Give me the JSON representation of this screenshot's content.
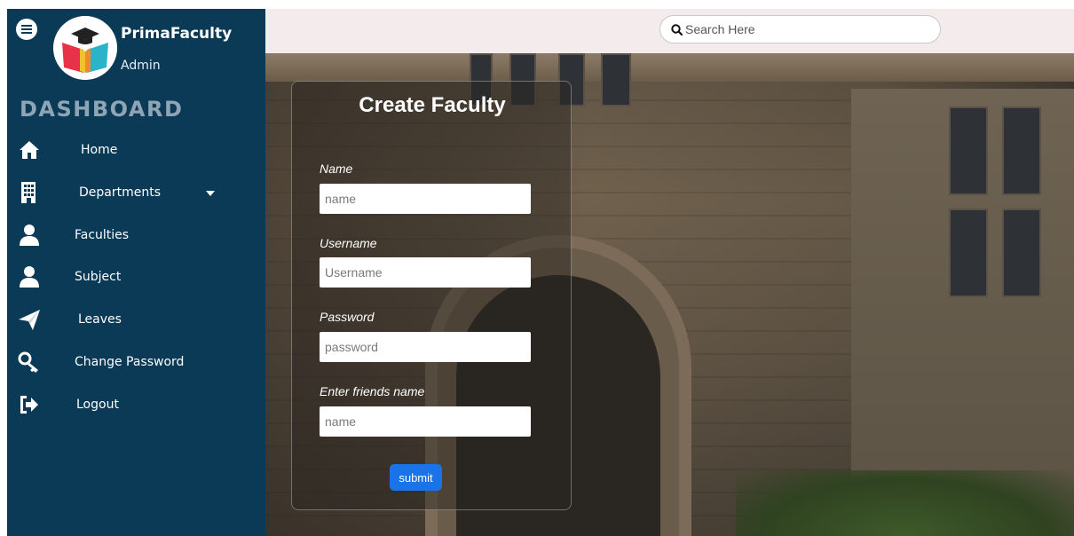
{
  "brand": {
    "name": "PrimaFaculty",
    "role": "Admin",
    "logo_icon": "graduation-cap-book-logo"
  },
  "sidebar": {
    "title": "DASHBOARD",
    "items": [
      {
        "label": "Home",
        "icon": "home-icon"
      },
      {
        "label": "Departments",
        "icon": "building-icon",
        "has_dropdown": true
      },
      {
        "label": "Faculties",
        "icon": "user-icon"
      },
      {
        "label": "Subject",
        "icon": "user-icon"
      },
      {
        "label": "Leaves",
        "icon": "paper-plane-icon"
      },
      {
        "label": "Change Password",
        "icon": "key-icon"
      },
      {
        "label": "Logout",
        "icon": "sign-out-icon"
      }
    ]
  },
  "search": {
    "placeholder": "Search Here",
    "icon": "search-icon"
  },
  "form": {
    "title": "Create Faculty",
    "fields": [
      {
        "label": "Name",
        "placeholder": "name"
      },
      {
        "label": "Username",
        "placeholder": "Username"
      },
      {
        "label": "Password",
        "placeholder": "password"
      },
      {
        "label": "Enter friends name",
        "placeholder": "name"
      }
    ],
    "submit_label": "submit"
  },
  "colors": {
    "sidebar_bg": "#0b3a57",
    "topbar_bg": "#f4ecec",
    "dashboard_title": "#8fa5b6",
    "submit_button": "#1a73e8"
  }
}
